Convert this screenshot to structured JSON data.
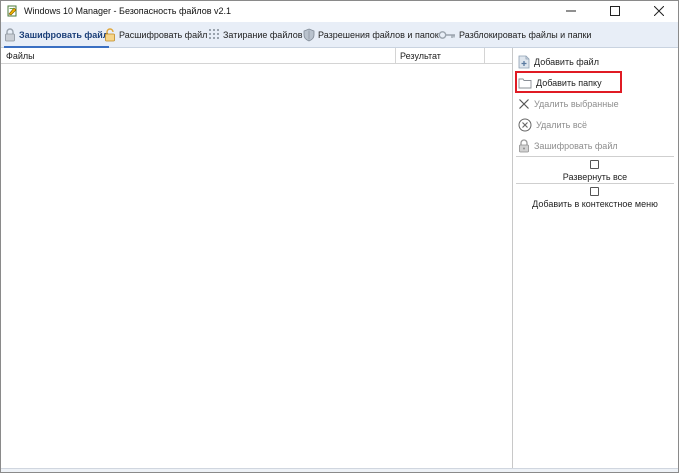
{
  "window": {
    "title": "Windows 10 Manager - Безопасность файлов v2.1"
  },
  "tabs": [
    {
      "label": "Зашифровать файл",
      "icon": "lock-icon",
      "active": true
    },
    {
      "label": "Расшифровать файл",
      "icon": "unlock-icon",
      "active": false
    },
    {
      "label": "Затирание файлов",
      "icon": "shred-icon",
      "active": false
    },
    {
      "label": "Разрешения файлов и папок",
      "icon": "shield-icon",
      "active": false
    },
    {
      "label": "Разблокировать файлы и папки",
      "icon": "key-icon",
      "active": false
    }
  ],
  "table": {
    "columns": [
      "Файлы",
      "Результат"
    ],
    "rows": []
  },
  "panel": {
    "add_file": "Добавить файл",
    "add_folder": "Добавить папку",
    "remove_selected": "Удалить выбранные",
    "remove_all": "Удалить всё",
    "encrypt_file": "Зашифровать файл",
    "expand_all": "Развернуть все",
    "add_context_menu": "Добавить в контекстное меню"
  },
  "colors": {
    "highlight": "#e01b24",
    "tabbar": "#e8eef7",
    "accent": "#3a6fc2"
  }
}
